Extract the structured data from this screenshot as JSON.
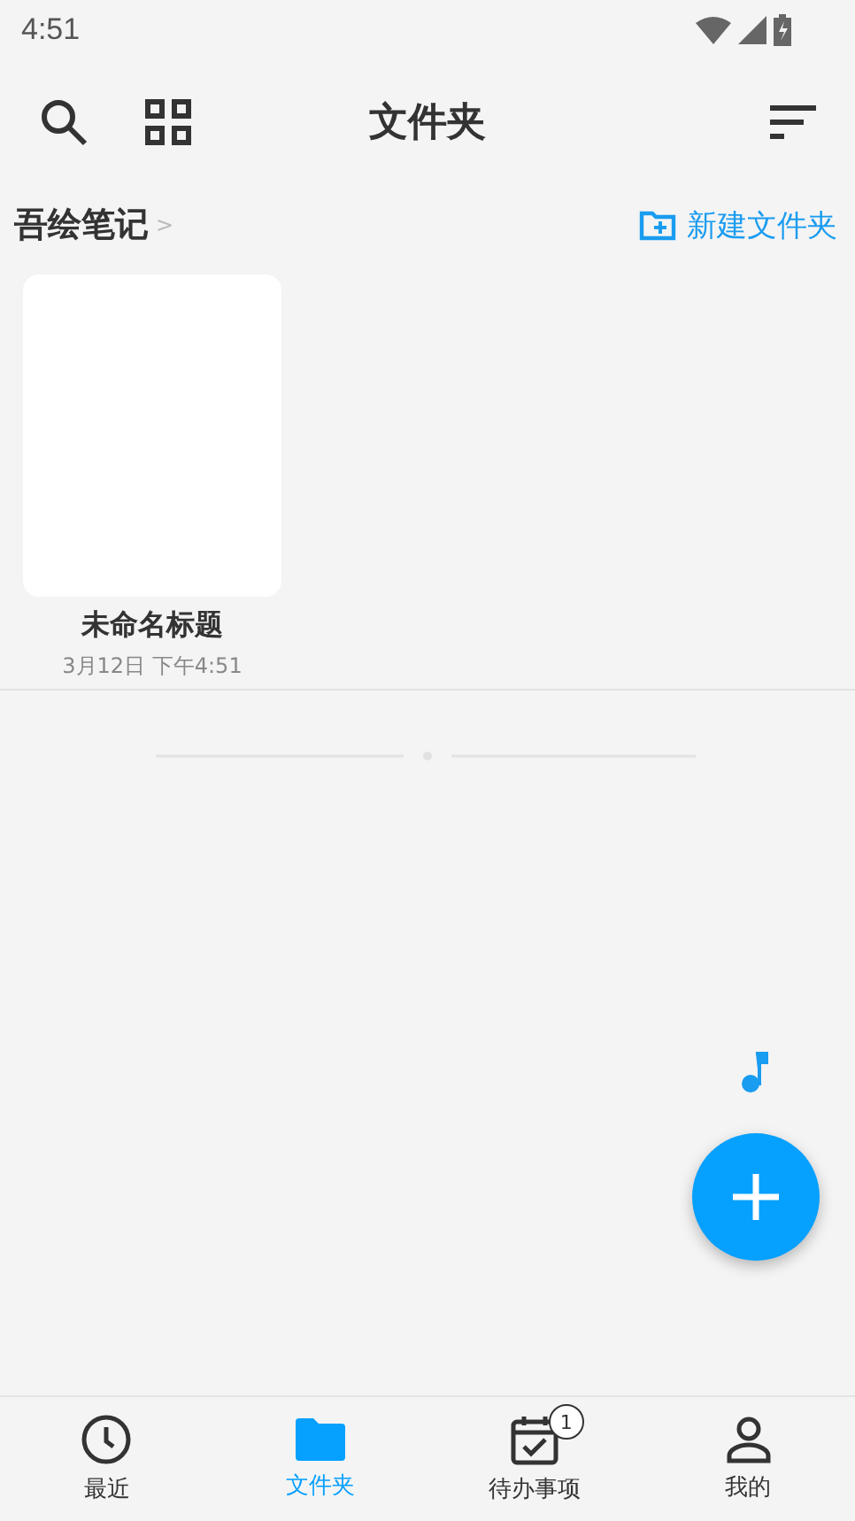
{
  "status_bar": {
    "time": "4:51"
  },
  "header": {
    "title": "文件夹"
  },
  "breadcrumb": {
    "label": "吾绘笔记",
    "separator": ">",
    "new_folder": "新建文件夹"
  },
  "notes": [
    {
      "title": "未命名标题",
      "date": "3月12日 下午4:51"
    }
  ],
  "bottom_nav": [
    {
      "kind": "clock",
      "label": "最近",
      "selected": false
    },
    {
      "kind": "folder",
      "label": "文件夹",
      "selected": true
    },
    {
      "kind": "calendar",
      "label": "待办事项",
      "selected": false,
      "badge": "1"
    },
    {
      "kind": "person",
      "label": "我的",
      "selected": false
    }
  ]
}
